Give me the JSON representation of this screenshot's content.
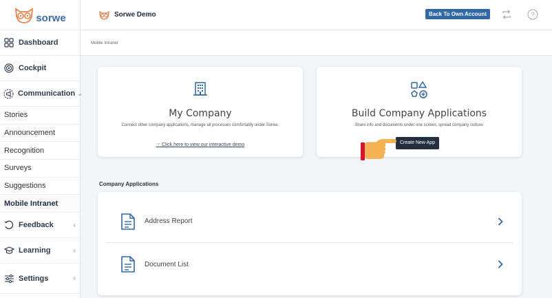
{
  "brand": {
    "logo_text": "sorwe",
    "accent": "#2f67a8",
    "logo_color": "#e8824a"
  },
  "sidebar": {
    "items": [
      {
        "label": "Dashboard",
        "icon": "dashboard-grid-icon"
      },
      {
        "label": "Cockpit",
        "icon": "target-icon"
      },
      {
        "label": "Communication",
        "icon": "megaphone-icon",
        "expanded": true
      }
    ],
    "sub_items": [
      "Stories",
      "Announcement",
      "Recognition",
      "Surveys",
      "Suggestions",
      "Mobile Intranet"
    ],
    "active_sub": "Mobile Intranet",
    "bottom_items": [
      {
        "label": "Feedback",
        "icon": "feedback-icon"
      },
      {
        "label": "Learning",
        "icon": "graduation-cap-icon"
      },
      {
        "label": "Settings",
        "icon": "sliders-icon"
      }
    ]
  },
  "header": {
    "title": "Sorwe Demo",
    "back_button": "Back To Own Account"
  },
  "breadcrumb": "Mobile Intranet",
  "my_company": {
    "title": "My Company",
    "description": "Connect other company applications, manage all processes comfortably under Sorwe.",
    "link": "Click here to view our interactive demo",
    "icon": "building-icon"
  },
  "build_apps": {
    "title": "Build Company Applications",
    "description": "Share info and documents under one screen, spread company culture.",
    "create_button": "Create New App",
    "icon": "shapes-add-icon"
  },
  "apps_section": {
    "label": "Company Applications",
    "apps": [
      {
        "name": "Address Report"
      },
      {
        "name": "Document List"
      }
    ]
  }
}
